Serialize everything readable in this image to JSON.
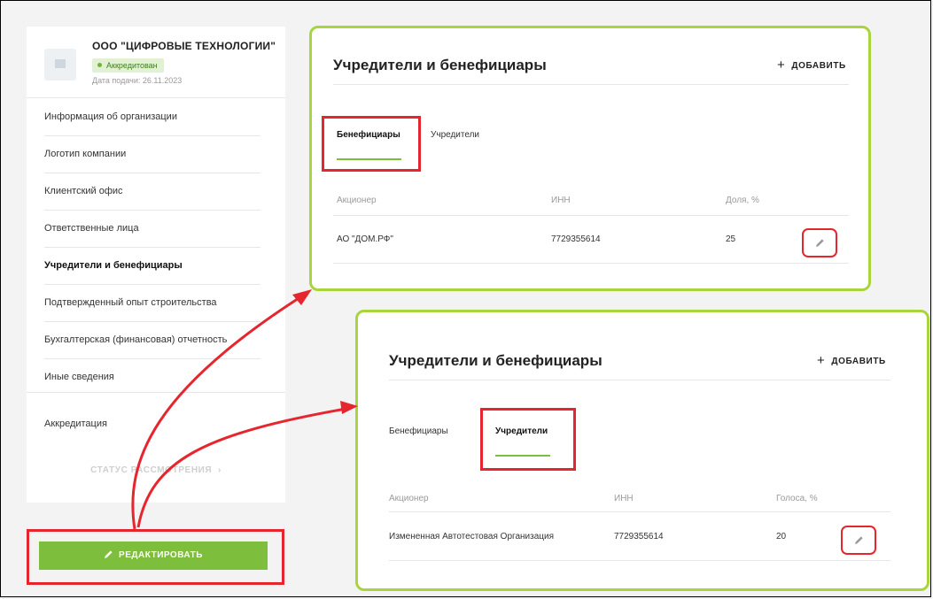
{
  "sidebar": {
    "org_name": "ООО \"ЦИФРОВЫЕ ТЕХНОЛОГИИ\"",
    "status_badge": "Аккредитован",
    "submission_date": "Дата подачи: 26.11.2023",
    "items": [
      {
        "label": "Информация об организации"
      },
      {
        "label": "Логотип компании"
      },
      {
        "label": "Клиентский офис"
      },
      {
        "label": "Ответственные лица"
      },
      {
        "label": "Учредители и бенефициары"
      },
      {
        "label": "Подтвержденный опыт строительства"
      },
      {
        "label": "Бухгалтерская (финансовая) отчетность"
      },
      {
        "label": "Иные сведения"
      },
      {
        "label": "Аккредитация"
      }
    ],
    "active_item": "Учредители и бенефициары",
    "status_link": "СТАТУС РАССМОТРЕНИЯ"
  },
  "edit_button": {
    "label": "РЕДАКТИРОВАТЬ",
    "icon": "pencil-icon"
  },
  "panel_beneficiaries": {
    "title": "Учредители и бенефициары",
    "add_label": "ДОБАВИТЬ",
    "tabs": [
      "Бенефициары",
      "Учредители"
    ],
    "active_tab": "Бенефициары",
    "columns": [
      "Акционер",
      "ИНН",
      "Доля, %"
    ],
    "rows": [
      {
        "name": "АО \"ДОМ.РФ\"",
        "inn": "7729355614",
        "value": "25"
      }
    ]
  },
  "panel_founders": {
    "title": "Учредители и бенефициары",
    "add_label": "ДОБАВИТЬ",
    "tabs": [
      "Бенефициары",
      "Учредители"
    ],
    "active_tab": "Учредители",
    "columns": [
      "Акционер",
      "ИНН",
      "Голоса, %"
    ],
    "rows": [
      {
        "name": "Измененная Автотестовая Организация",
        "inn": "7729355614",
        "value": "20"
      }
    ]
  },
  "colors": {
    "accent_green": "#7dbe3c",
    "card_border": "#a9d53c",
    "highlight_red": "#e6262f",
    "badge_bg": "#e2f1d3"
  }
}
